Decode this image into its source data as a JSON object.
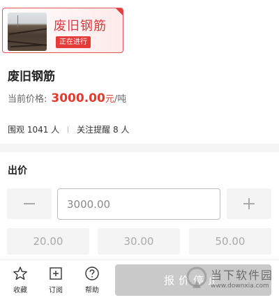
{
  "header_card": {
    "title": "废旧钢筋",
    "status_badge": "正在进行",
    "accent_color": "#e63b3b"
  },
  "product": {
    "title": "废旧钢筋",
    "price_label": "当前价格:",
    "price_value": "3000.00",
    "price_unit_currency": "元",
    "price_unit_per": "/吨",
    "watchers_text": "围观 1041 人",
    "reminders_text": "关注提醒 8 人"
  },
  "bid": {
    "section_title": "出价",
    "minus_icon": "minus-icon",
    "plus_icon": "plus-icon",
    "input_value": "3000.00",
    "quick_amounts": [
      "20.00",
      "30.00",
      "50.00"
    ]
  },
  "bottom_bar": {
    "favorite_label": "收藏",
    "subscribe_label": "订阅",
    "help_label": "帮助",
    "submit_label": "报价停止"
  },
  "watermark": {
    "cn": "当下软件园",
    "en": "www.downxia.com"
  }
}
